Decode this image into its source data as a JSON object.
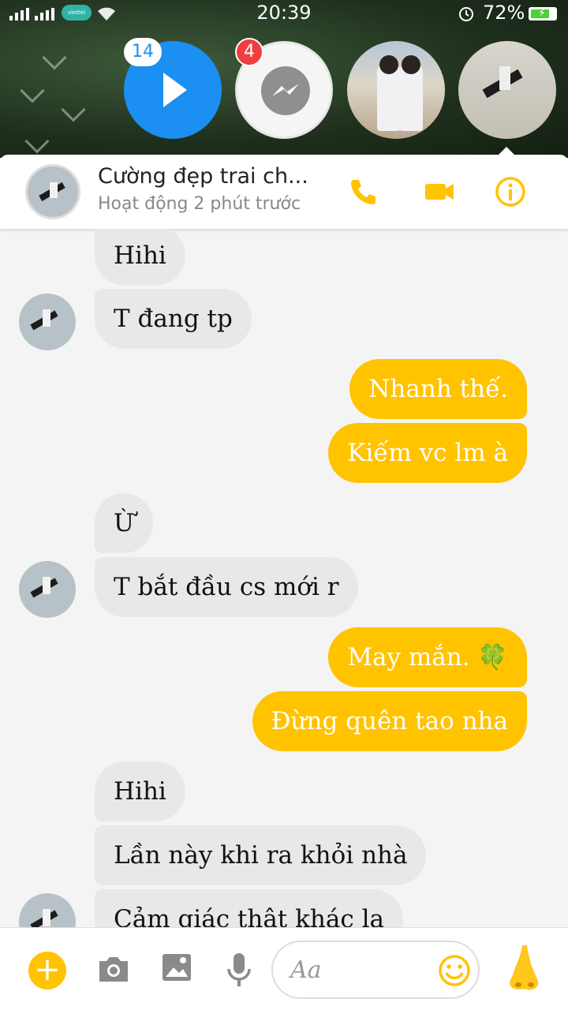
{
  "status_bar": {
    "carrier": "viettel",
    "time": "20:39",
    "battery_percent": "72%",
    "battery_level": 0.72
  },
  "chat_heads": [
    {
      "name": "video-head",
      "badge": "14"
    },
    {
      "name": "messenger-head",
      "badge": "4"
    },
    {
      "name": "photo-head-1"
    },
    {
      "name": "photo-head-2"
    }
  ],
  "header": {
    "contact_name": "Cường đẹp trai ch...",
    "contact_status": "Hoạt động 2 phút trước",
    "icons": [
      "phone-icon",
      "video-camera-icon",
      "info-icon"
    ],
    "accent_color": "#ffc300"
  },
  "messages": [
    {
      "dir": "in",
      "text": "Hihi"
    },
    {
      "dir": "in",
      "text": "T đang tp"
    },
    {
      "dir": "out",
      "text": "Nhanh thế."
    },
    {
      "dir": "out",
      "text": "Kiếm vc lm à"
    },
    {
      "dir": "in",
      "text": "Ừ"
    },
    {
      "dir": "in",
      "text": "T bắt đầu cs mới r"
    },
    {
      "dir": "out",
      "text": "May mắn. 🍀"
    },
    {
      "dir": "out",
      "text": "Đừng quên tao nha"
    },
    {
      "dir": "in",
      "text": "Hihi"
    },
    {
      "dir": "in",
      "text": "Lần này khi ra khỏi nhà"
    },
    {
      "dir": "in",
      "text": "Cảm giác thật khác lạ"
    }
  ],
  "composer": {
    "placeholder": "Aa",
    "icons": [
      "plus-icon",
      "camera-icon",
      "image-icon",
      "microphone-icon",
      "smiley-icon",
      "nose-emoji-icon"
    ]
  }
}
